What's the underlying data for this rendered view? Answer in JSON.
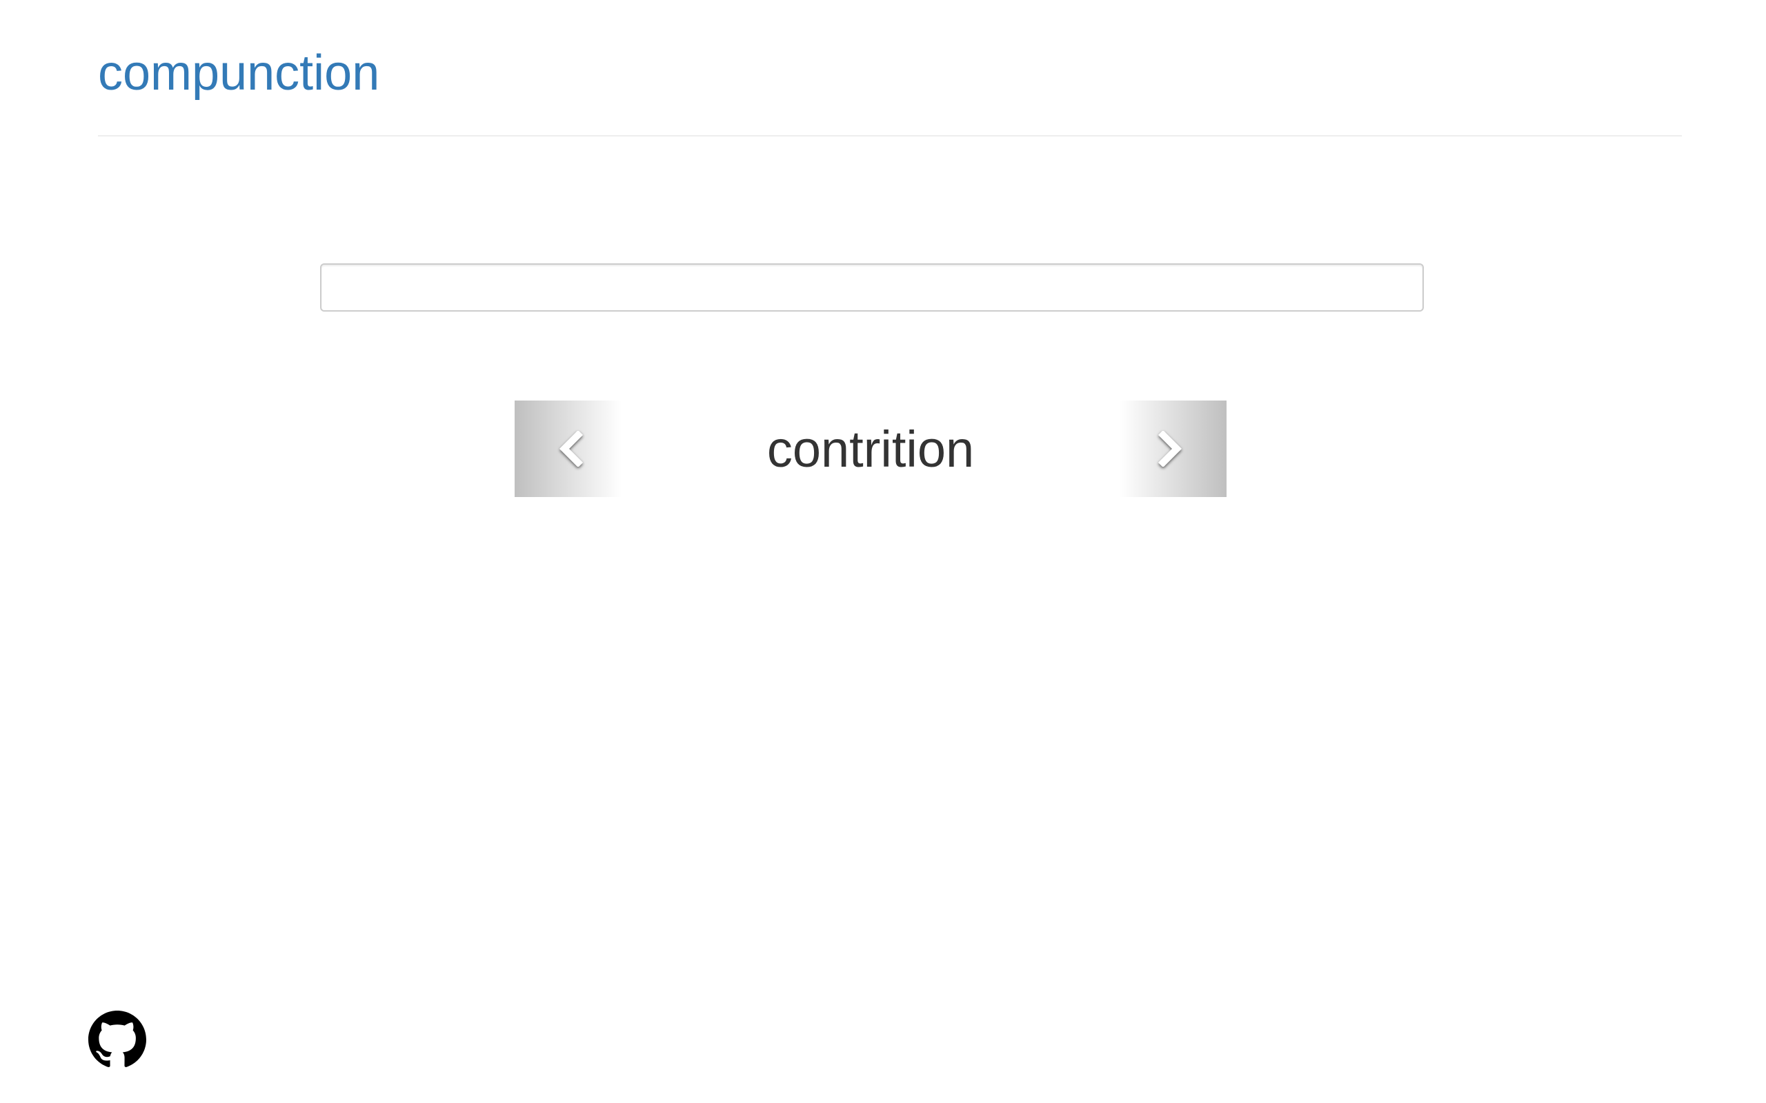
{
  "header": {
    "title": "compunction"
  },
  "search": {
    "value": "",
    "placeholder": ""
  },
  "carousel": {
    "current_word": "contrition",
    "prev_icon": "chevron-left-icon",
    "next_icon": "chevron-right-icon"
  },
  "footer": {
    "github_icon": "github-icon"
  },
  "colors": {
    "title": "#337ab7",
    "word": "#333333",
    "border": "#cccccc"
  }
}
